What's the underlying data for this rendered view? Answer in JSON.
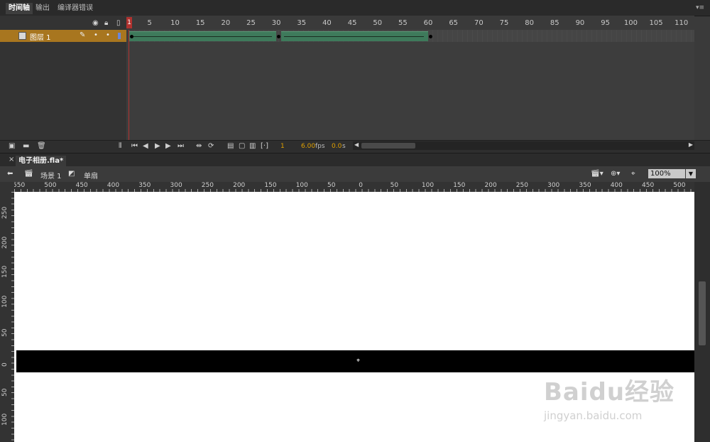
{
  "panel_tabs": [
    {
      "label": "时间轴",
      "active": true
    },
    {
      "label": "输出",
      "active": false
    },
    {
      "label": "编译器错误",
      "active": false
    }
  ],
  "timeline": {
    "ruler_labels": [
      "1",
      "5",
      "10",
      "15",
      "20",
      "25",
      "30",
      "35",
      "40",
      "45",
      "50",
      "55",
      "60",
      "65",
      "70",
      "75",
      "80",
      "85",
      "90",
      "95",
      "100",
      "105",
      "110"
    ],
    "current_frame_marker": "1",
    "layer": {
      "name": "图层 1"
    },
    "header_icons": [
      "eye-icon",
      "lock-icon",
      "outline-icon"
    ],
    "keyframes": [
      1,
      30,
      60
    ],
    "tweens": [
      {
        "start": 1,
        "end": 29
      },
      {
        "start": 31,
        "end": 59
      }
    ],
    "toolbar": {
      "current_frame": "1",
      "fps": "6.00",
      "fps_unit": "fps",
      "time": "0.0",
      "time_unit": "s"
    }
  },
  "document": {
    "tab_label": "电子相册.fla*",
    "scene_label": "场景 1",
    "symbol_label": "单扇",
    "zoom": "100%"
  },
  "rulers": {
    "horizontal": [
      "550",
      "500",
      "450",
      "400",
      "350",
      "300",
      "250",
      "200",
      "150",
      "100",
      "50",
      "0",
      "50",
      "100",
      "150",
      "200",
      "250",
      "300",
      "350",
      "400",
      "450",
      "500"
    ],
    "vertical": [
      "250",
      "200",
      "150",
      "100",
      "50",
      "0",
      "50",
      "100"
    ]
  },
  "watermark": {
    "logo": "Baidu经验",
    "url": "jingyan.baidu.com"
  },
  "colors": {
    "layer_highlight": "#a8761f",
    "tween": "#3e7a5b",
    "playhead": "#b0322f",
    "fps_text": "#e0a000"
  }
}
